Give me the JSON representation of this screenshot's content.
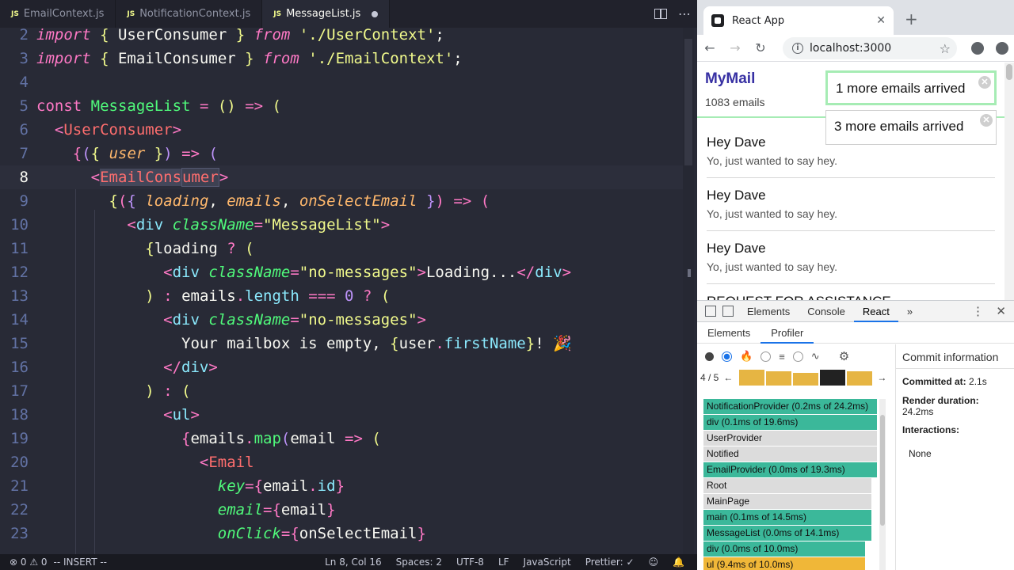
{
  "editor": {
    "tabs": [
      {
        "label": "EmailContext.js",
        "badge": "JS"
      },
      {
        "label": "NotificationContext.js",
        "badge": "JS"
      },
      {
        "label": "MessageList.js",
        "badge": "JS"
      }
    ],
    "status": {
      "errors": "0",
      "warnings": "0",
      "mode": "-- INSERT --",
      "position": "Ln 8, Col 16",
      "spaces": "Spaces: 2",
      "encoding": "UTF-8",
      "eol": "LF",
      "language": "JavaScript",
      "formatter": "Prettier: ✓"
    },
    "line_numbers": [
      "2",
      "3",
      "4",
      "5",
      "6",
      "7",
      "8",
      "9",
      "10",
      "11",
      "12",
      "13",
      "14",
      "15",
      "16",
      "17",
      "18",
      "19",
      "20",
      "21",
      "22",
      "23"
    ]
  },
  "browser": {
    "tab_title": "React App",
    "url": "localhost:3000",
    "app": {
      "brand": "MyMail",
      "email_count": "1083 emails",
      "toasts": [
        "1 more emails arrived",
        "3 more emails arrived"
      ],
      "emails": [
        {
          "subject": "Hey Dave",
          "preview": "Yo, just wanted to say hey."
        },
        {
          "subject": "Hey Dave",
          "preview": "Yo, just wanted to say hey."
        },
        {
          "subject": "Hey Dave",
          "preview": "Yo, just wanted to say hey."
        },
        {
          "subject": "REQUEST FOR ASSISTANCE",
          "preview": ""
        }
      ]
    },
    "devtools": {
      "tabs": [
        "Elements",
        "Console",
        "React"
      ],
      "more": "»",
      "sub_tabs": [
        "Elements",
        "Profiler"
      ],
      "commit_index": "4 / 5",
      "flame_rows": [
        {
          "label": "NotificationProvider (0.2ms of 24.2ms)",
          "kind": "teal"
        },
        {
          "label": "div (0.1ms of 19.6ms)",
          "kind": "teal"
        },
        {
          "label": "UserProvider",
          "kind": "grey"
        },
        {
          "label": "Notified",
          "kind": "grey"
        },
        {
          "label": "EmailProvider (0.0ms of 19.3ms)",
          "kind": "teal"
        },
        {
          "label": "Root",
          "kind": "grey"
        },
        {
          "label": "MainPage",
          "kind": "grey"
        },
        {
          "label": "main (0.1ms of 14.5ms)",
          "kind": "teal"
        },
        {
          "label": "MessageList (0.0ms of 14.1ms)",
          "kind": "teal"
        },
        {
          "label": "div (0.0ms of 10.0ms)",
          "kind": "teal"
        },
        {
          "label": "ul (9.4ms of 10.0ms)",
          "kind": "yellow"
        }
      ],
      "commit_info": {
        "title": "Commit information",
        "committed_label": "Committed at:",
        "committed_value": "2.1s",
        "render_label": "Render duration:",
        "render_value": "24.2ms",
        "interactions_label": "Interactions:",
        "interactions_value": "None"
      }
    }
  }
}
